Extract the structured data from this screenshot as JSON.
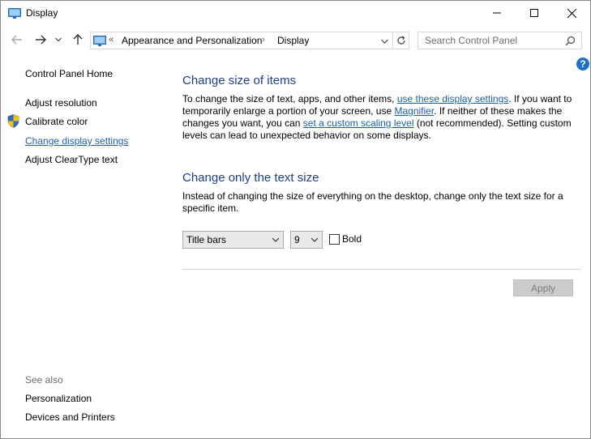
{
  "window": {
    "title": "Display",
    "minimize_glyph": "—",
    "maximize_glyph": "☐",
    "close_glyph": "✕"
  },
  "address": {
    "overflow": "«",
    "crumb1": "Appearance and Personalization",
    "separator": "›",
    "crumb2": "Display"
  },
  "search": {
    "placeholder": "Search Control Panel"
  },
  "help": {
    "label": "?"
  },
  "sidebar": {
    "home": "Control Panel Home",
    "items": [
      "Adjust resolution",
      "Calibrate color",
      "Change display settings",
      "Adjust ClearType text"
    ],
    "see_also_label": "See also",
    "see_also": [
      "Personalization",
      "Devices and Printers"
    ]
  },
  "main": {
    "section1_title": "Change size of items",
    "p1_a": "To change the size of text, apps, and other items, ",
    "p1_link1": "use these display settings",
    "p1_b": ".  If you want to temporarily enlarge a portion of your screen, use ",
    "p1_link2": "Magnifier",
    "p1_c": ".  If neither of these makes the changes you want, you can ",
    "p1_link3": "set a custom scaling level",
    "p1_d": " (not recommended).  Setting custom levels can lead to unexpected behavior on some displays.",
    "section2_title": "Change only the text size",
    "p2": "Instead of changing the size of everything on the desktop, change only the text size for a specific item.",
    "item_select": "Title bars",
    "size_select": "9",
    "bold_label": "Bold",
    "bold_checked": false,
    "apply_label": "Apply"
  },
  "colors": {
    "heading": "#1e3f87",
    "link": "#1a5fb4",
    "help_bg": "#1e6fc6"
  }
}
